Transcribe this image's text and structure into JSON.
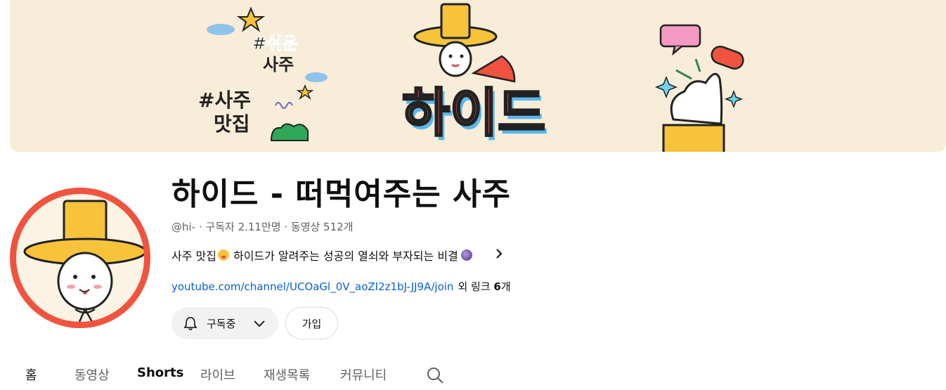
{
  "banner": {
    "logo_text": "하이드",
    "tag1_line1": "#쉬운",
    "tag1_line2": "사주",
    "tag2_line1": "#사주",
    "tag2_line2": "맛집"
  },
  "channel": {
    "title": "하이드 - 떠먹여주는 사주",
    "handle": "@hi-",
    "separator": " · ",
    "subscribers": "구독자 2.11만명",
    "videos": "동영상 512개",
    "description_part1": "사주 맛집",
    "description_part2": "하이드가 알려주는 성공의 열쇠와 부자되는 비결",
    "link_url": "youtube.com/channel/UCOaGl_0V_aoZI2z1bJ-JJ9A/join",
    "more_links_prefix": "외 링크 ",
    "more_links_count": "6",
    "more_links_suffix": "개"
  },
  "actions": {
    "subscribed_label": "구독중",
    "join_label": "가입"
  },
  "tabs": [
    {
      "label": "홈"
    },
    {
      "label": "동영상"
    },
    {
      "label": "Shorts"
    },
    {
      "label": "라이브"
    },
    {
      "label": "재생목록"
    },
    {
      "label": "커뮤니티"
    }
  ],
  "colors": {
    "banner_bg": "#f7edd8",
    "avatar_ring": "#f0533f",
    "hat_yellow": "#f7c33b",
    "link_blue": "#065fd4",
    "logo_red": "#f0533f"
  },
  "icons": {
    "bell": "bell-icon",
    "chevron": "chevron-down-icon",
    "search": "search-icon",
    "desc_more": "chevron-right-icon"
  }
}
